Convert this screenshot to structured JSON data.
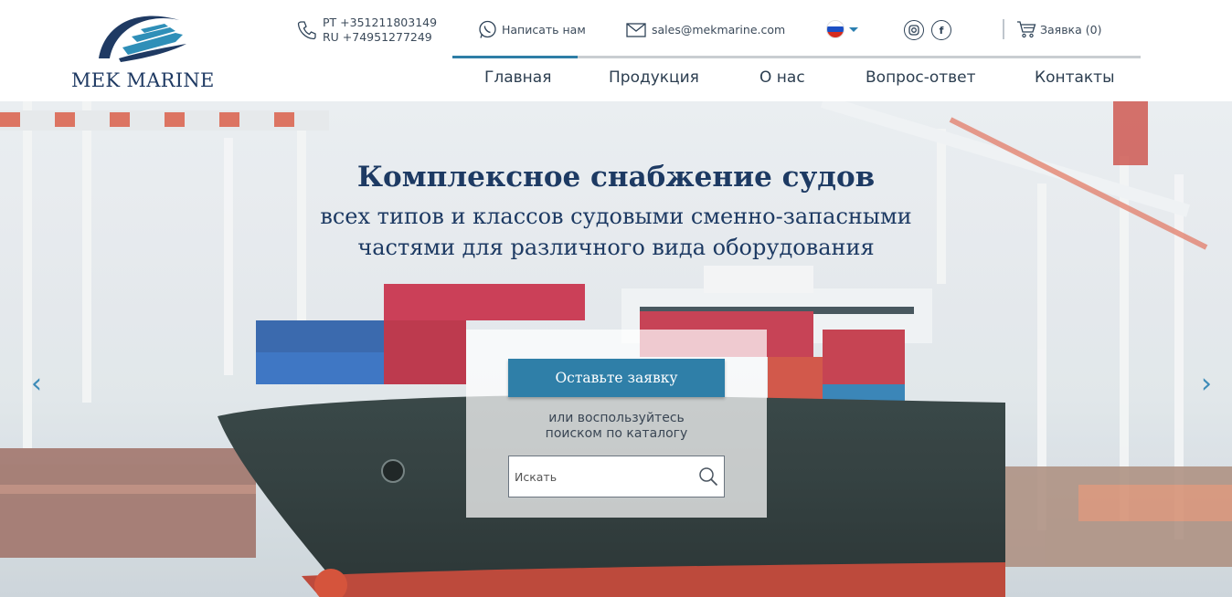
{
  "brand": {
    "name": "MEK MARINE"
  },
  "header": {
    "phones": [
      "PT +351211803149",
      "RU +74951277249"
    ],
    "whatsapp_label": "Написать нам",
    "email": "sales@mekmarine.com",
    "language": "RU",
    "social": {
      "instagram": "instagram-icon",
      "facebook": "f"
    },
    "cart_label": "Заявка (0)"
  },
  "nav": {
    "items": [
      {
        "label": "Главная",
        "active": true
      },
      {
        "label": "Продукция"
      },
      {
        "label": "О нас"
      },
      {
        "label": "Вопрос-ответ"
      },
      {
        "label": "Контакты"
      }
    ]
  },
  "hero": {
    "title": "Комплексное снабжение судов",
    "subtitle_line1": "всех типов и классов судовыми сменно-запасными",
    "subtitle_line2": "частями для различного вида оборудования",
    "cta_label": "Оставьте заявку",
    "or_line1": "или воспользуйтесь",
    "or_line2": "поиском по каталогу",
    "search_placeholder": "Искать",
    "prev_arrow": "‹",
    "next_arrow": "›"
  },
  "colors": {
    "accent": "#2f7fa8",
    "brand_navy": "#1d3a63",
    "nav_text": "#2c3e50"
  }
}
